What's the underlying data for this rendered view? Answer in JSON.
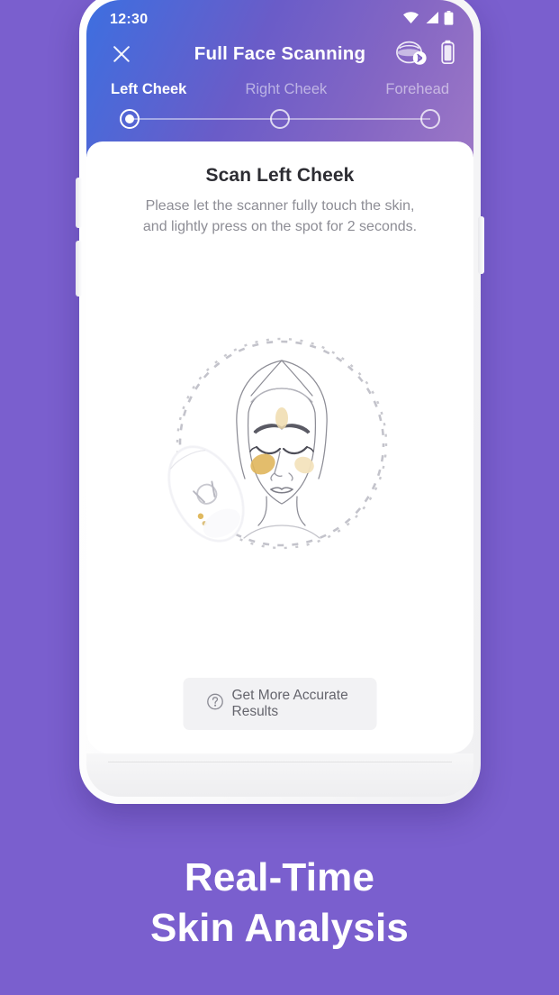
{
  "background_color": "#7a5fce",
  "phone": {
    "status_bar": {
      "time": "12:30",
      "icons": [
        "wifi-icon",
        "cellular-signal-icon",
        "battery-icon"
      ]
    },
    "hardware": {
      "volume_up": "volume-up-button",
      "volume_down": "volume-down-button",
      "power": "power-button"
    }
  },
  "header": {
    "close_icon": "close-icon",
    "title": "Full Face Scanning",
    "actions": [
      {
        "name": "scanner-bluetooth-icon",
        "label": "scanner device connected via bluetooth"
      },
      {
        "name": "device-battery-icon",
        "label": "device battery"
      }
    ],
    "gradient_from": "#3d6fe0",
    "gradient_to": "#9c77c6"
  },
  "tabs": [
    {
      "label": "Left Cheek",
      "active": true
    },
    {
      "label": "Right Cheek",
      "active": false
    },
    {
      "label": "Forehead",
      "active": false
    }
  ],
  "stepper": {
    "steps": [
      {
        "name": "step-left-cheek",
        "active": true
      },
      {
        "name": "step-right-cheek",
        "active": false
      },
      {
        "name": "step-forehead",
        "active": false
      }
    ]
  },
  "card": {
    "title": "Scan Left Cheek",
    "instruction": "Please let the scanner fully touch the skin, and lightly press on the spot for 2 seconds.",
    "illustration": {
      "name": "face-scan-illustration",
      "ring": "dashed-circle-ring",
      "face": "line-art-female-face-closed-eyes",
      "device": "handheld-skin-scanner",
      "highlight_spots": [
        {
          "name": "left-cheek-spot",
          "color": "#e3b860"
        },
        {
          "name": "right-cheek-spot",
          "color": "#f0dcb4"
        },
        {
          "name": "forehead-spot",
          "color": "#f2e2bb"
        }
      ]
    },
    "help_button": {
      "icon": "question-mark-icon",
      "label": "Get More Accurate Results"
    }
  },
  "promo": {
    "line1": "Real-Time",
    "line2": "Skin Analysis",
    "color": "#ffffff"
  }
}
